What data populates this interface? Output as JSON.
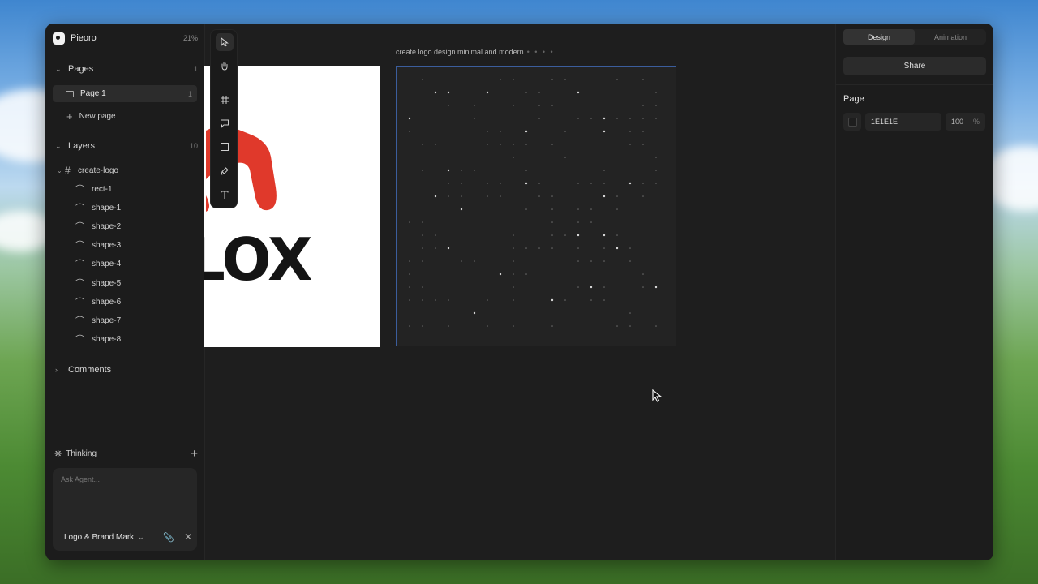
{
  "app": {
    "name": "Pieoro",
    "zoom": "21%"
  },
  "sidebar": {
    "pages_label": "Pages",
    "pages_count": "1",
    "pages": [
      {
        "label": "Page 1",
        "count": "1"
      }
    ],
    "new_page_label": "New page",
    "layers_label": "Layers",
    "layers_count": "10",
    "frame_layer": "create-logo",
    "layers": [
      "rect-1",
      "shape-1",
      "shape-2",
      "shape-3",
      "shape-4",
      "shape-5",
      "shape-6",
      "shape-7",
      "shape-8"
    ],
    "comments_label": "Comments"
  },
  "agent": {
    "status": "Thinking",
    "placeholder": "Ask Agent...",
    "mode": "Logo & Brand Mark"
  },
  "canvas": {
    "frame_label": "create logo design minimal and modern",
    "frame_label_dots": "• • • •",
    "logo_text": "LOX",
    "logo_accent": "#e0392b",
    "selection_color": "#3b5d9c"
  },
  "right_panel": {
    "tabs": [
      {
        "label": "Design",
        "active": true
      },
      {
        "label": "Animation",
        "active": false
      }
    ],
    "share_label": "Share",
    "section_title": "Page",
    "fill_hex": "1E1E1E",
    "opacity": "100",
    "opacity_unit": "%"
  },
  "toolbar": {
    "tools": [
      {
        "name": "move-tool",
        "icon": "pointer-icon"
      },
      {
        "name": "hand-tool",
        "icon": "hand-icon"
      },
      {
        "name": "frame-tool",
        "icon": "hash-icon"
      },
      {
        "name": "comment-tool",
        "icon": "comment-icon"
      },
      {
        "name": "rectangle-tool",
        "icon": "square-icon"
      },
      {
        "name": "pen-tool",
        "icon": "pen-icon"
      },
      {
        "name": "text-tool",
        "icon": "text-icon"
      }
    ]
  }
}
